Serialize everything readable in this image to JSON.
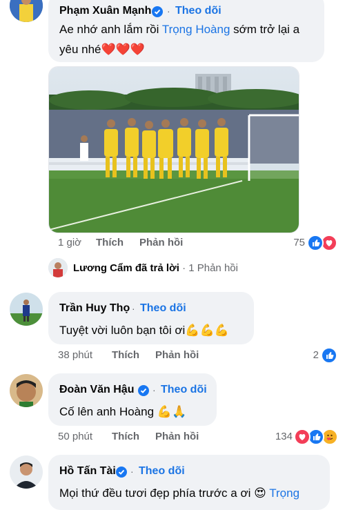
{
  "comments": [
    {
      "author": "Phạm Xuân Mạnh",
      "follow": "Theo dõi",
      "text_before": "Ae nhớ anh lắm rồi ",
      "mention": "Trọng Hoàng",
      "text_after": " sớm trở lại a",
      "text_line2": "yêu nhé",
      "emojis": "❤️❤️❤️",
      "time": "1 giờ",
      "like": "Thích",
      "reply": "Phản hồi",
      "reaction_count": "75"
    },
    {
      "author": "Trần Huy Thọ",
      "follow": "Theo dõi",
      "text": "Tuyệt vời luôn bạn tôi ơi",
      "emojis": "💪💪💪",
      "time": "38 phút",
      "like": "Thích",
      "reply": "Phản hồi",
      "reaction_count": "2"
    },
    {
      "author": "Đoàn Văn Hậu",
      "follow": "Theo dõi",
      "text": "Cố lên anh Hoàng ",
      "emojis": "💪🙏",
      "time": "50 phút",
      "like": "Thích",
      "reply": "Phản hồi",
      "reaction_count": "134"
    },
    {
      "author": "Hồ Tấn Tài",
      "follow": "Theo dõi",
      "text": "Mọi thứ đều tươi đẹp phía trước a ơi ",
      "emoji": "😍",
      "mention": "Trọng"
    }
  ],
  "reply_summary": {
    "replier": "Lương Cẩm",
    "action": "đã trả lời",
    "separator": "·",
    "count": "1 Phản hồi"
  },
  "dot": "·",
  "colors": {
    "link": "#1b74e4",
    "bubble": "#f0f2f5",
    "meta": "#65676b",
    "like_blue": "#1877f2",
    "love_red": "#f33e58"
  },
  "icons": [
    "verified-badge-icon",
    "like-reaction-icon",
    "love-reaction-icon",
    "care-reaction-icon"
  ]
}
